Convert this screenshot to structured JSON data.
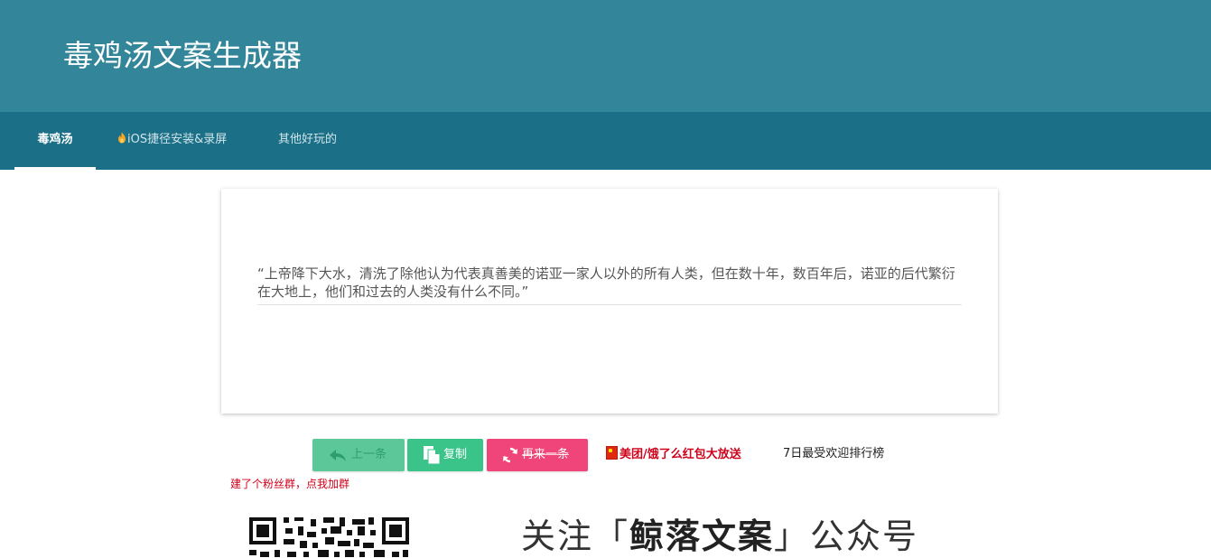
{
  "header": {
    "title": "毒鸡汤文案生成器"
  },
  "tabs": [
    {
      "label": "毒鸡汤",
      "active": true
    },
    {
      "label": "iOS捷径安装&录屏",
      "icon": "fire-icon"
    },
    {
      "label": "其他好玩的"
    }
  ],
  "quote": {
    "text": "“上帝降下大水，清洗了除他认为代表真善美的诺亚一家人以外的所有人类，但在数十年，数百年后，诺亚的后代繁衍在大地上，他们和过去的人类没有什么不同。”"
  },
  "buttons": {
    "prev": {
      "label": "上一条",
      "icon": "reply-arrow-icon"
    },
    "copy": {
      "label": "复制",
      "icon": "copy-icon"
    },
    "next": {
      "label": "再来一条",
      "icon": "refresh-icon"
    }
  },
  "links": {
    "promo": "美团/饿了么红包大放送",
    "promo_icon": "china-flag-icon",
    "rank": "7日最受欢迎排行榜",
    "group": "建了个粉丝群，点我加群"
  },
  "banner": {
    "prefix": "关注「",
    "brand": "鲸落文案",
    "suffix": "」公众号"
  },
  "colors": {
    "header": "#338699",
    "tabs": "#1b7087",
    "prev_button": "#5cc89a",
    "copy_button": "#3ac48a",
    "next_button": "#f0457a",
    "link_red": "#d0021b"
  }
}
